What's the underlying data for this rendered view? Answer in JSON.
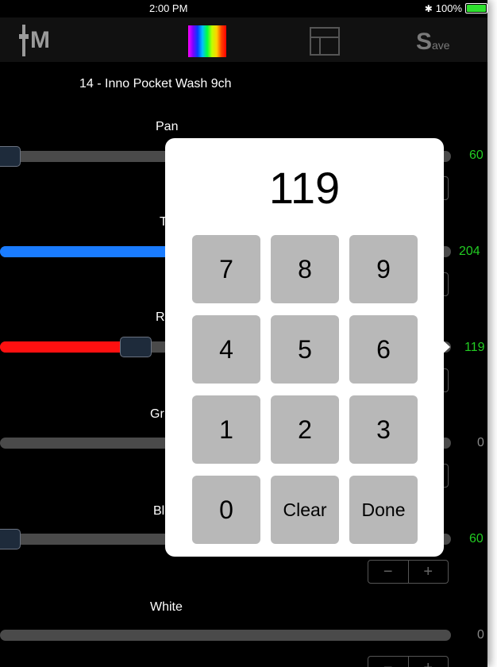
{
  "status_bar": {
    "time": "2:00 PM",
    "bluetooth": "✱",
    "battery": "100%"
  },
  "toolbar": {
    "mode_label": "M",
    "save_big": "S",
    "save_small": "ave"
  },
  "device_title": "14 - Inno Pocket Wash 9ch",
  "channels": [
    {
      "label": "Pan",
      "value": "60",
      "value_color": "#22cc22",
      "fill_color": ""
    },
    {
      "label": "T",
      "value": "204",
      "value_color": "#22cc22",
      "fill_color": "#1a7cff"
    },
    {
      "label": "R",
      "value": "119",
      "value_color": "#22cc22",
      "fill_color": "#ff1010"
    },
    {
      "label": "Gr",
      "value": "0",
      "value_color": "#888888",
      "fill_color": ""
    },
    {
      "label": "Bl",
      "value": "60",
      "value_color": "#22cc22",
      "fill_color": ""
    },
    {
      "label": "White",
      "value": "0",
      "value_color": "#888888",
      "fill_color": ""
    }
  ],
  "stepper": {
    "minus": "−",
    "plus": "+"
  },
  "keypad": {
    "display": "119",
    "keys": [
      "7",
      "8",
      "9",
      "4",
      "5",
      "6",
      "1",
      "2",
      "3",
      "0",
      "Clear",
      "Done"
    ]
  }
}
